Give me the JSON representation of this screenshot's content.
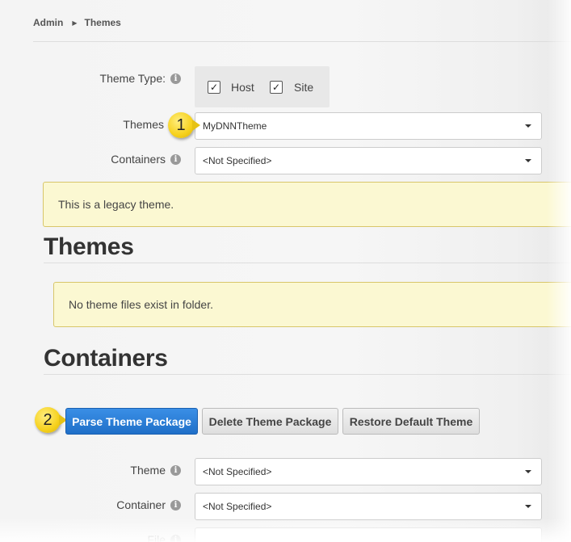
{
  "breadcrumb": {
    "root": "Admin",
    "current": "Themes"
  },
  "theme_type": {
    "label": "Theme Type:",
    "host_label": "Host",
    "host_checked": true,
    "site_label": "Site",
    "site_checked": true
  },
  "themes_select": {
    "label": "Themes",
    "value": "MyDNNTheme"
  },
  "containers_select": {
    "label": "Containers",
    "value": "<Not Specified>"
  },
  "legacy_notice": "This is a legacy theme.",
  "themes_section": {
    "heading": "Themes",
    "notice": "No theme files exist in folder."
  },
  "containers_section": {
    "heading": "Containers"
  },
  "buttons": {
    "parse": "Parse Theme Package",
    "delete": "Delete Theme Package",
    "restore": "Restore Default Theme"
  },
  "bottom_form": {
    "theme_label": "Theme",
    "theme_value": "<Not Specified>",
    "container_label": "Container",
    "container_value": "<Not Specified>",
    "file_label": "File"
  },
  "callouts": {
    "one": "1",
    "two": "2"
  },
  "icons": {
    "info": "info-icon",
    "check": "check-icon",
    "caret": "caret-down-icon",
    "breadcrumb_sep": "caret-right-icon"
  },
  "colors": {
    "primary": "#2b7fd8",
    "alert_bg": "#fbf8d2",
    "callout": "#f6d11c"
  }
}
